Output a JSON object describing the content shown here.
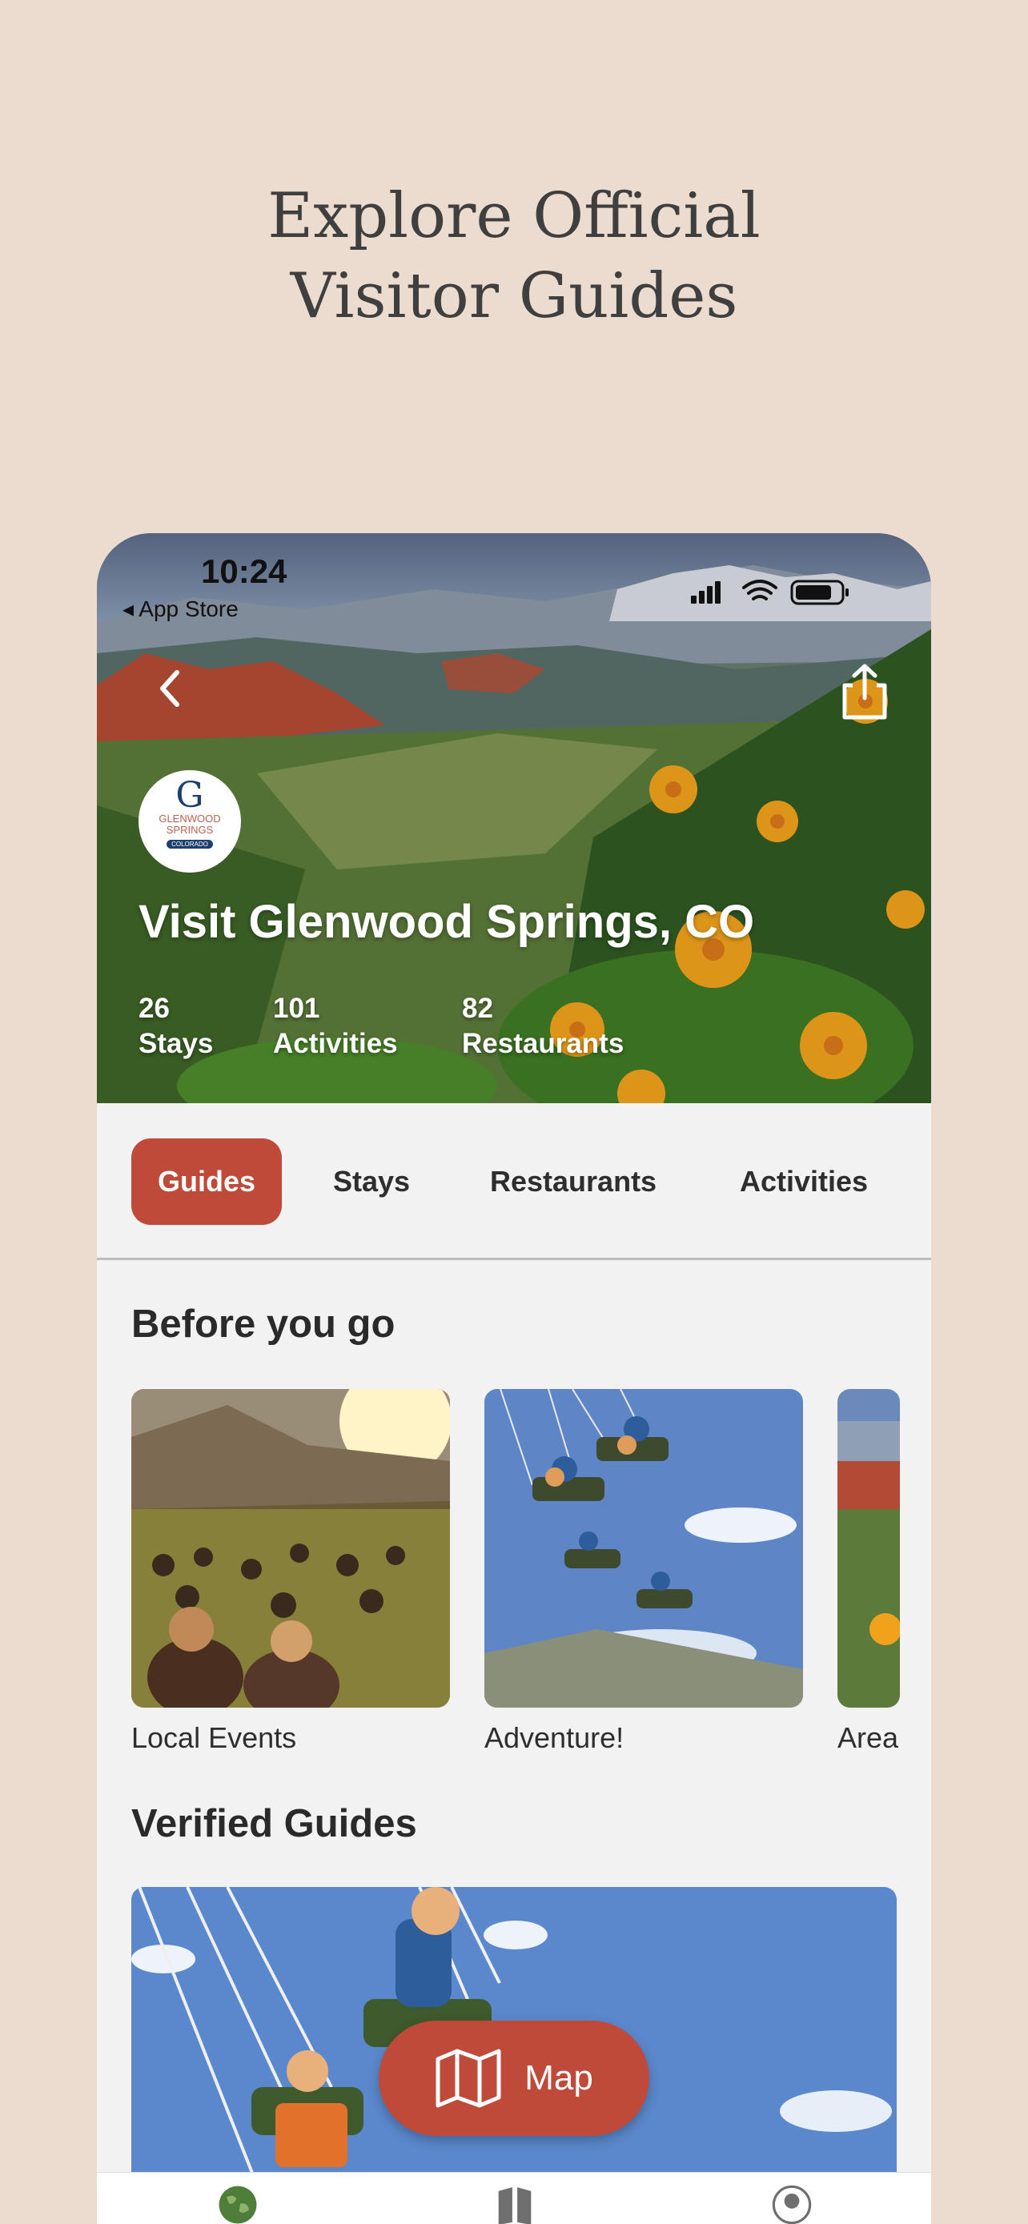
{
  "headline": {
    "line1": "Explore Official",
    "line2": "Visitor Guides"
  },
  "status_bar": {
    "time": "10:24",
    "back_app": "◂ App Store"
  },
  "hero": {
    "logo": {
      "letter": "G",
      "line1": "GLENWOOD",
      "line2": "SPRINGS",
      "badge": "COLORADO"
    },
    "title": "Visit Glenwood Springs, CO",
    "stats": [
      {
        "value": "26",
        "label": "Stays"
      },
      {
        "value": "101",
        "label": "Activities"
      },
      {
        "value": "82",
        "label": "Restaurants"
      }
    ]
  },
  "tabs": [
    {
      "label": "Guides",
      "active": true
    },
    {
      "label": "Stays",
      "active": false
    },
    {
      "label": "Restaurants",
      "active": false
    },
    {
      "label": "Activities",
      "active": false
    }
  ],
  "before_you_go": {
    "title": "Before you go",
    "cards": [
      {
        "label": "Local Events",
        "icon": "concert-crowd-photo"
      },
      {
        "label": "Adventure!",
        "icon": "swing-ride-photo"
      },
      {
        "label": "Area",
        "icon": "valley-photo"
      }
    ]
  },
  "verified_guides": {
    "title": "Verified Guides"
  },
  "map_button": {
    "label": "Map",
    "icon": "map-icon"
  },
  "tab_bar": {
    "icons": [
      "globe-icon",
      "book-icon",
      "profile-icon"
    ]
  },
  "colors": {
    "background": "#ecdccf",
    "accent": "#c04a3a",
    "panel": "#f2f2f2"
  }
}
